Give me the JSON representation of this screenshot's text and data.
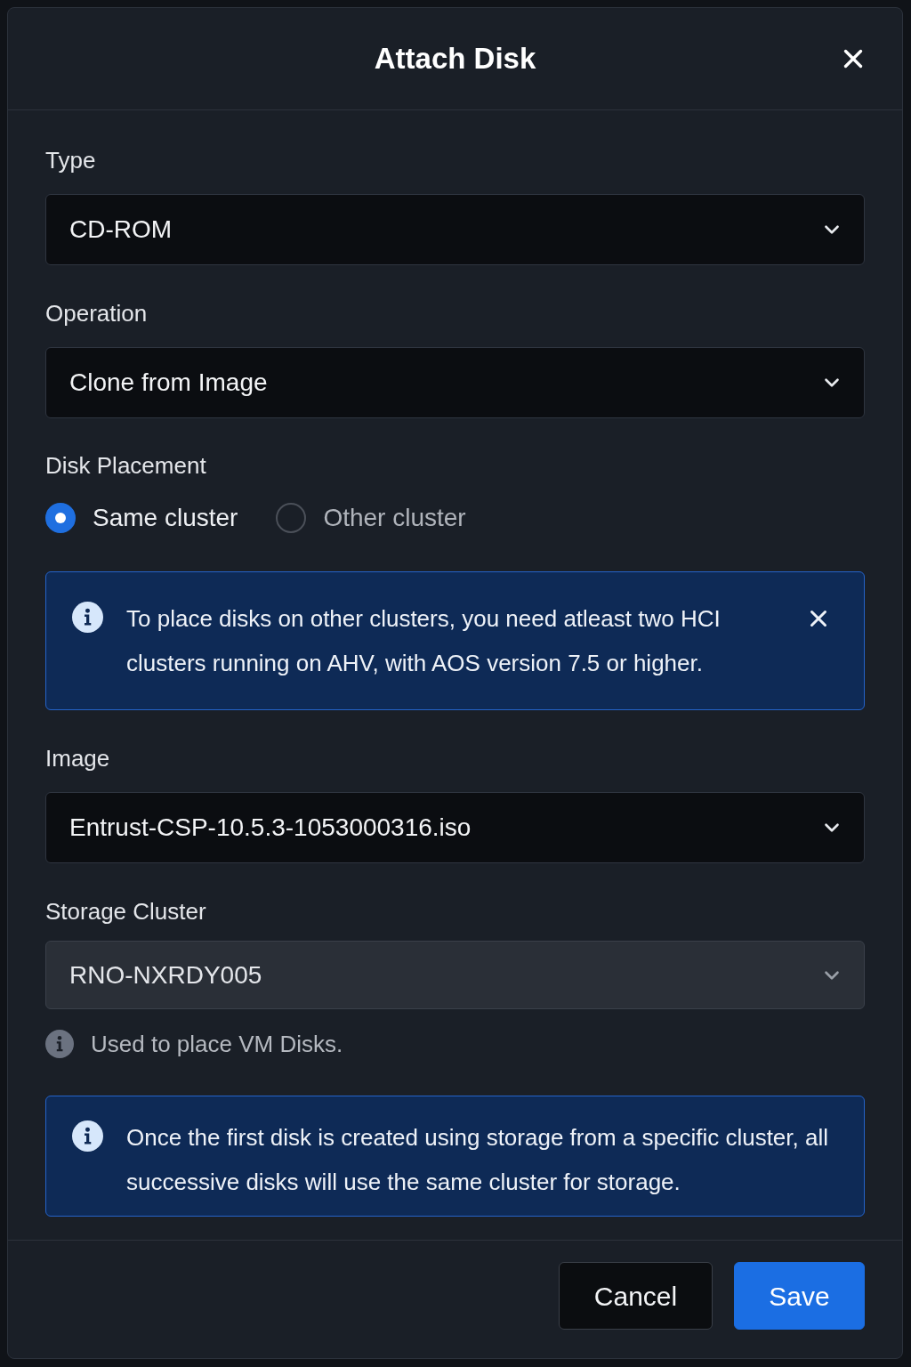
{
  "dialog": {
    "title": "Attach Disk"
  },
  "fields": [
    {
      "kind": "select",
      "label": "Type",
      "value": "CD-ROM",
      "disabled": false
    },
    {
      "kind": "select",
      "label": "Operation",
      "value": "Clone from Image",
      "disabled": false
    },
    {
      "kind": "radio_group",
      "label": "Disk Placement",
      "options": [
        {
          "label": "Same cluster",
          "selected": true
        },
        {
          "label": "Other cluster",
          "selected": false
        }
      ]
    },
    {
      "kind": "alert",
      "text": "To place disks on other clusters, you need atleast two HCI clusters running on AHV, with AOS version 7.5 or higher.",
      "dismissible": true
    },
    {
      "kind": "select",
      "label": "Image",
      "value": "Entrust-CSP-10.5.3-1053000316.iso",
      "disabled": false
    },
    {
      "kind": "select",
      "label": "Storage Cluster",
      "value": "RNO-NXRDY005",
      "disabled": true,
      "hint": "Used to place VM Disks."
    },
    {
      "kind": "alert",
      "text": "Once the first disk is created using storage from a specific cluster, all successive disks will use the same cluster for storage.",
      "dismissible": false
    }
  ],
  "buttons": [
    {
      "label": "Cancel",
      "kind": "secondary"
    },
    {
      "label": "Save",
      "kind": "primary"
    }
  ]
}
